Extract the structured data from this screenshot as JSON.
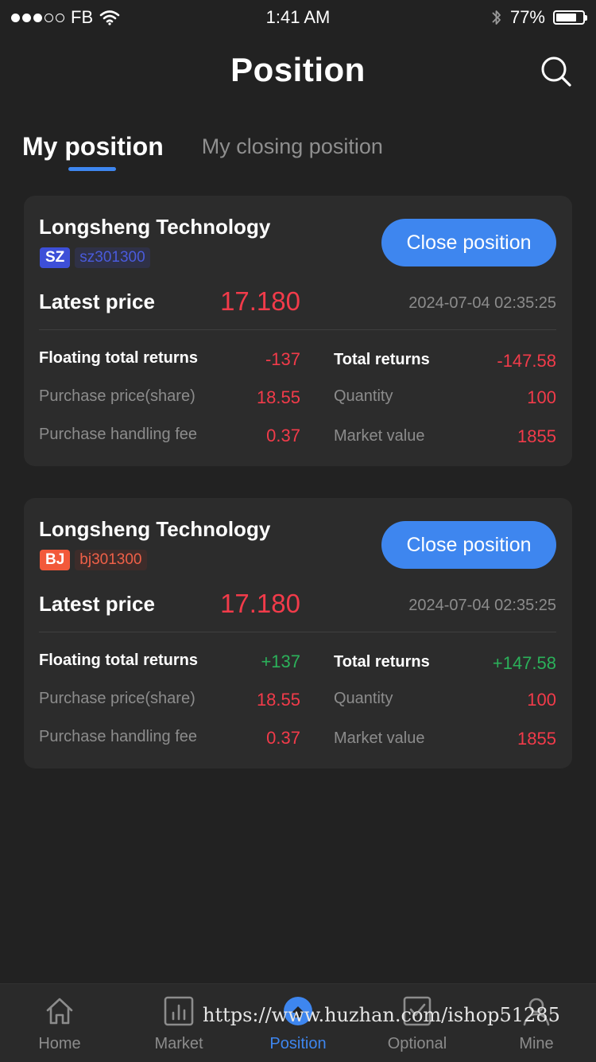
{
  "status": {
    "carrier": "FB",
    "time": "1:41 AM",
    "battery": "77%",
    "battery_level": 0.77
  },
  "header": {
    "title": "Position"
  },
  "tabs": [
    {
      "label": "My position"
    },
    {
      "label": "My closing position"
    }
  ],
  "labels": {
    "latest_price": "Latest price",
    "floating_total_returns": "Floating total returns",
    "total_returns": "Total returns",
    "purchase_price": "Purchase price(share)",
    "quantity": "Quantity",
    "handling_fee": "Purchase handling fee",
    "market_value": "Market value",
    "close_button": "Close position"
  },
  "positions": [
    {
      "name": "Longsheng Technology",
      "exchange": "SZ",
      "exchange_color": "#3d4fd8",
      "code": "sz301300",
      "code_color": "#4a5bdc",
      "code_bg": "#2f3147",
      "latest_price": "17.180",
      "timestamp": "2024-07-04 02:35:25",
      "floating_total_returns": "-137",
      "total_returns": "-147.58",
      "purchase_price": "18.55",
      "quantity": "100",
      "handling_fee": "0.37",
      "market_value": "1855"
    },
    {
      "name": "Longsheng Technology",
      "exchange": "BJ",
      "exchange_color": "#f2593a",
      "code": "bj301300",
      "code_color": "#f06048",
      "code_bg": "#3d2c2a",
      "latest_price": "17.180",
      "timestamp": "2024-07-04 02:35:25",
      "floating_total_returns": "+137",
      "total_returns": "+147.58",
      "purchase_price": "18.55",
      "quantity": "100",
      "handling_fee": "0.37",
      "market_value": "1855"
    }
  ],
  "tabbar": [
    {
      "label": "Home",
      "icon": "home-icon"
    },
    {
      "label": "Market",
      "icon": "market-icon"
    },
    {
      "label": "Position",
      "icon": "position-icon"
    },
    {
      "label": "Optional",
      "icon": "optional-icon"
    },
    {
      "label": "Mine",
      "icon": "mine-icon"
    }
  ],
  "watermark": "https://www.huzhan.com/ishop51285",
  "colors": {
    "accent": "#3e86ef",
    "loss": "#f23b4a",
    "gain": "#2bb15a",
    "background": "#222222",
    "card": "#2c2c2c"
  }
}
